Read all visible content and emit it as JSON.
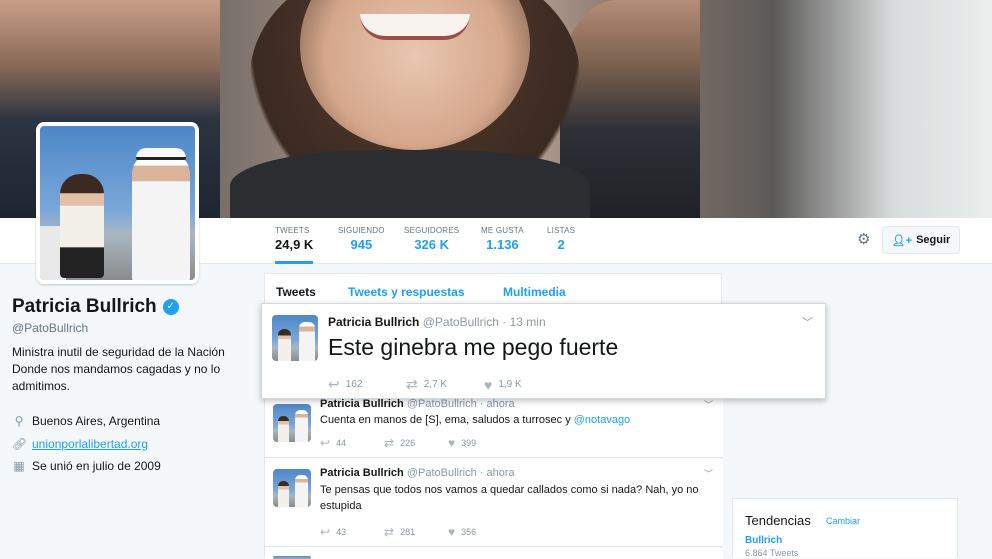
{
  "profile": {
    "name": "Patricia Bullrich",
    "handle": "@PatoBullrich",
    "bio": "Ministra inutil de seguridad de la Nación Donde nos mandamos cagadas y no lo admitimos.",
    "location": "Buenos Aires, Argentina",
    "website": "unionporlalibertad.org",
    "joined": "Se unió en julio de 2009",
    "icons": [
      "location-pin-icon",
      "link-icon",
      "calendar-icon",
      "verified-badge-icon"
    ]
  },
  "nav": {
    "stats": [
      {
        "label": "TWEETS",
        "value": "24,9 K"
      },
      {
        "label": "SIGUIENDO",
        "value": "945"
      },
      {
        "label": "SEGUIDORES",
        "value": "326 K"
      },
      {
        "label": "ME GUSTA",
        "value": "1.136"
      },
      {
        "label": "LISTAS",
        "value": "2"
      }
    ],
    "follow_label": "Seguir"
  },
  "tabs": [
    "Tweets",
    "Tweets y respuestas",
    "Multimedia"
  ],
  "popup_tweet": {
    "name": "Patricia Bullrich",
    "handle": "@PatoBullrich",
    "time": "13 min",
    "text": "Este ginebra me pego fuerte",
    "replies": "162",
    "retweets": "2,7 K",
    "likes": "1,9 K"
  },
  "tweets": [
    {
      "name": "Patricia Bullrich",
      "handle": "@PatoBullrich",
      "time": "ahora",
      "text": "Cuenta en manos de [S], ema, saludos a turrosec y ",
      "mention": "@notavago",
      "replies": "44",
      "retweets": "226",
      "likes": "399"
    },
    {
      "name": "Patricia Bullrich",
      "handle": "@PatoBullrich",
      "time": "ahora",
      "text": "Te pensas que todos nos vamos a quedar callados como si nada? Nah, yo no estupida",
      "replies": "43",
      "retweets": "281",
      "likes": "356"
    }
  ],
  "trends": {
    "title": "Tendencias",
    "change": "Cambiar",
    "item": "Bullrich",
    "count": "6.864 Tweets"
  }
}
